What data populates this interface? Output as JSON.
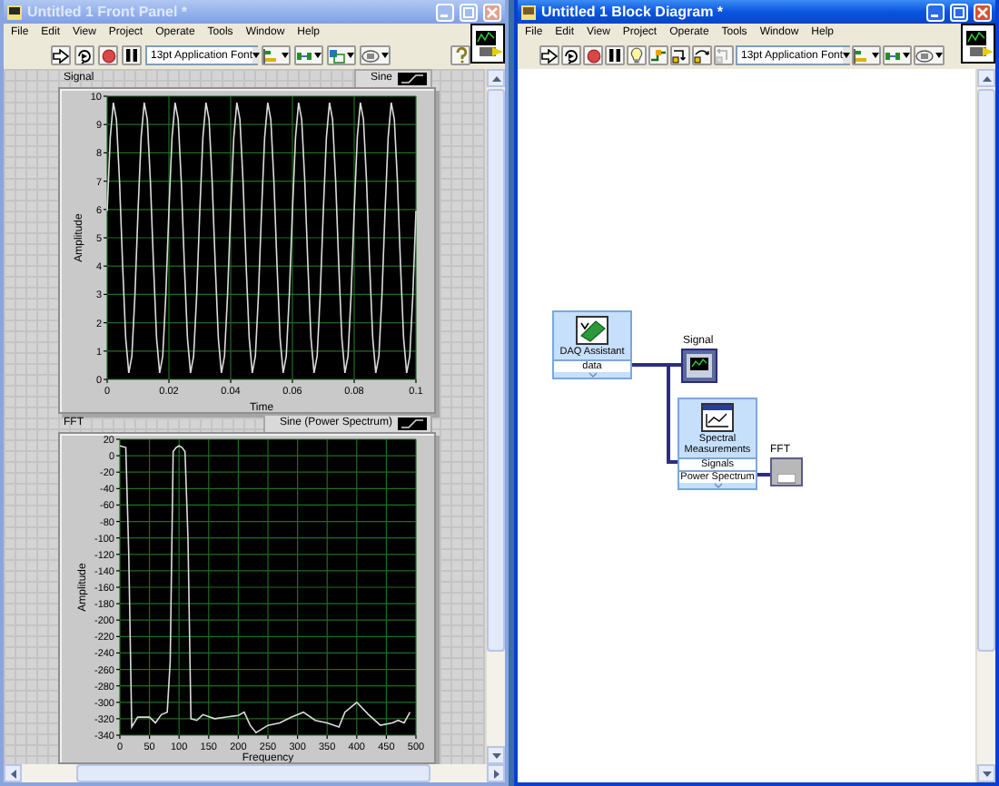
{
  "front_panel": {
    "title": "Untitled 1 Front Panel *",
    "active": false,
    "menu": [
      "File",
      "Edit",
      "View",
      "Project",
      "Operate",
      "Tools",
      "Window",
      "Help"
    ],
    "font_selector": "13pt Application Font",
    "graphs": [
      {
        "label": "Signal",
        "chart_data": {
          "type": "line",
          "grid": true,
          "xlabel": "Time",
          "ylabel": "Amplitude",
          "x": [
            0,
            0.001,
            0.002,
            0.003,
            0.004,
            0.005,
            0.006,
            0.007,
            0.008,
            0.009,
            0.01,
            0.011,
            0.012,
            0.013,
            0.014,
            0.015,
            0.016,
            0.017,
            0.018,
            0.019,
            0.02,
            0.021,
            0.022,
            0.023,
            0.024,
            0.025,
            0.026,
            0.027,
            0.028,
            0.029,
            0.03,
            0.031,
            0.032,
            0.033,
            0.034,
            0.035,
            0.036,
            0.037,
            0.038,
            0.039,
            0.04,
            0.041,
            0.042,
            0.043,
            0.044,
            0.045,
            0.046,
            0.047,
            0.048,
            0.049,
            0.05,
            0.051,
            0.052,
            0.053,
            0.054,
            0.055,
            0.056,
            0.057,
            0.058,
            0.059,
            0.06,
            0.061,
            0.062,
            0.063,
            0.064,
            0.065,
            0.066,
            0.067,
            0.068,
            0.069,
            0.07,
            0.071,
            0.072,
            0.073,
            0.074,
            0.075,
            0.076,
            0.077,
            0.078,
            0.079,
            0.08,
            0.081,
            0.082,
            0.083,
            0.084,
            0.085,
            0.086,
            0.087,
            0.088,
            0.089,
            0.09,
            0.091,
            0.092,
            0.093,
            0.094,
            0.095,
            0.096,
            0.097,
            0.098,
            0.099,
            0.1
          ],
          "series": [
            {
              "name": "Sine",
              "color": "#dcdcdc",
              "values": [
                5.95,
                8.54,
                9.77,
                9.18,
                7.0,
                4.05,
                1.46,
                0.23,
                0.82,
                3.0,
                5.95,
                8.54,
                9.77,
                9.18,
                7.0,
                4.05,
                1.46,
                0.23,
                0.82,
                3.0,
                5.95,
                8.54,
                9.77,
                9.18,
                7.0,
                4.05,
                1.46,
                0.23,
                0.82,
                3.0,
                5.95,
                8.54,
                9.77,
                9.18,
                7.0,
                4.05,
                1.46,
                0.23,
                0.82,
                3.0,
                5.95,
                8.54,
                9.77,
                9.18,
                7.0,
                4.05,
                1.46,
                0.23,
                0.82,
                3.0,
                5.95,
                8.54,
                9.77,
                9.18,
                7.0,
                4.05,
                1.46,
                0.23,
                0.82,
                3.0,
                5.95,
                8.54,
                9.77,
                9.18,
                7.0,
                4.05,
                1.46,
                0.23,
                0.82,
                3.0,
                5.95,
                8.54,
                9.77,
                9.18,
                7.0,
                4.05,
                1.46,
                0.23,
                0.82,
                3.0,
                5.95,
                8.54,
                9.77,
                9.18,
                7.0,
                4.05,
                1.46,
                0.23,
                0.82,
                3.0,
                5.95,
                8.54,
                9.77,
                9.18,
                7.0,
                4.05,
                1.46,
                0.23,
                0.82,
                3.0,
                5.95
              ]
            }
          ],
          "xlim": [
            0,
            0.1
          ],
          "ylim": [
            0,
            10
          ],
          "xticks": [
            0,
            0.02,
            0.04,
            0.06,
            0.08,
            0.1
          ],
          "yticks": [
            0,
            1,
            2,
            3,
            4,
            5,
            6,
            7,
            8,
            9,
            10
          ]
        }
      },
      {
        "label": "FFT",
        "chart_data": {
          "type": "line",
          "grid": true,
          "xlabel": "Frequency",
          "ylabel": "Amplitude",
          "x": [
            0,
            10,
            15,
            20,
            30,
            50,
            60,
            70,
            80,
            85,
            90,
            95,
            100,
            105,
            110,
            115,
            120,
            130,
            140,
            160,
            180,
            200,
            210,
            220,
            230,
            250,
            270,
            290,
            310,
            330,
            350,
            370,
            380,
            400,
            420,
            440,
            460,
            470,
            480,
            490
          ],
          "series": [
            {
              "name": "Sine (Power Spectrum)",
              "color": "#dcdcdc",
              "values": [
                12,
                10,
                -120,
                -330,
                -318,
                -318,
                -325,
                -315,
                -312,
                -250,
                5,
                10,
                12,
                10,
                5,
                -100,
                -320,
                -322,
                -315,
                -320,
                -318,
                -316,
                -312,
                -328,
                -337,
                -328,
                -325,
                -318,
                -312,
                -322,
                -325,
                -330,
                -312,
                -300,
                -315,
                -328,
                -325,
                -322,
                -325,
                -312
              ]
            }
          ],
          "xlim": [
            0,
            500
          ],
          "ylim": [
            -340,
            20
          ],
          "xticks": [
            0,
            50,
            100,
            150,
            200,
            250,
            300,
            350,
            400,
            450,
            500
          ],
          "yticks": [
            20,
            0,
            -20,
            -40,
            -60,
            -80,
            -100,
            -120,
            -140,
            -160,
            -180,
            -200,
            -220,
            -240,
            -260,
            -280,
            -300,
            -320,
            -340
          ]
        }
      }
    ]
  },
  "block_diagram": {
    "title": "Untitled 1 Block Diagram *",
    "active": true,
    "menu": [
      "File",
      "Edit",
      "View",
      "Project",
      "Operate",
      "Tools",
      "Window",
      "Help"
    ],
    "font_selector": "13pt Application Font",
    "nodes": [
      {
        "kind": "express",
        "name": "DAQ Assistant",
        "terminals": [
          "data"
        ]
      },
      {
        "kind": "indicator",
        "label": "Signal"
      },
      {
        "kind": "express",
        "name": "Spectral Measurements",
        "terminals": [
          "Signals",
          "Power Spectrum"
        ]
      },
      {
        "kind": "indicator",
        "label": "FFT"
      }
    ]
  }
}
